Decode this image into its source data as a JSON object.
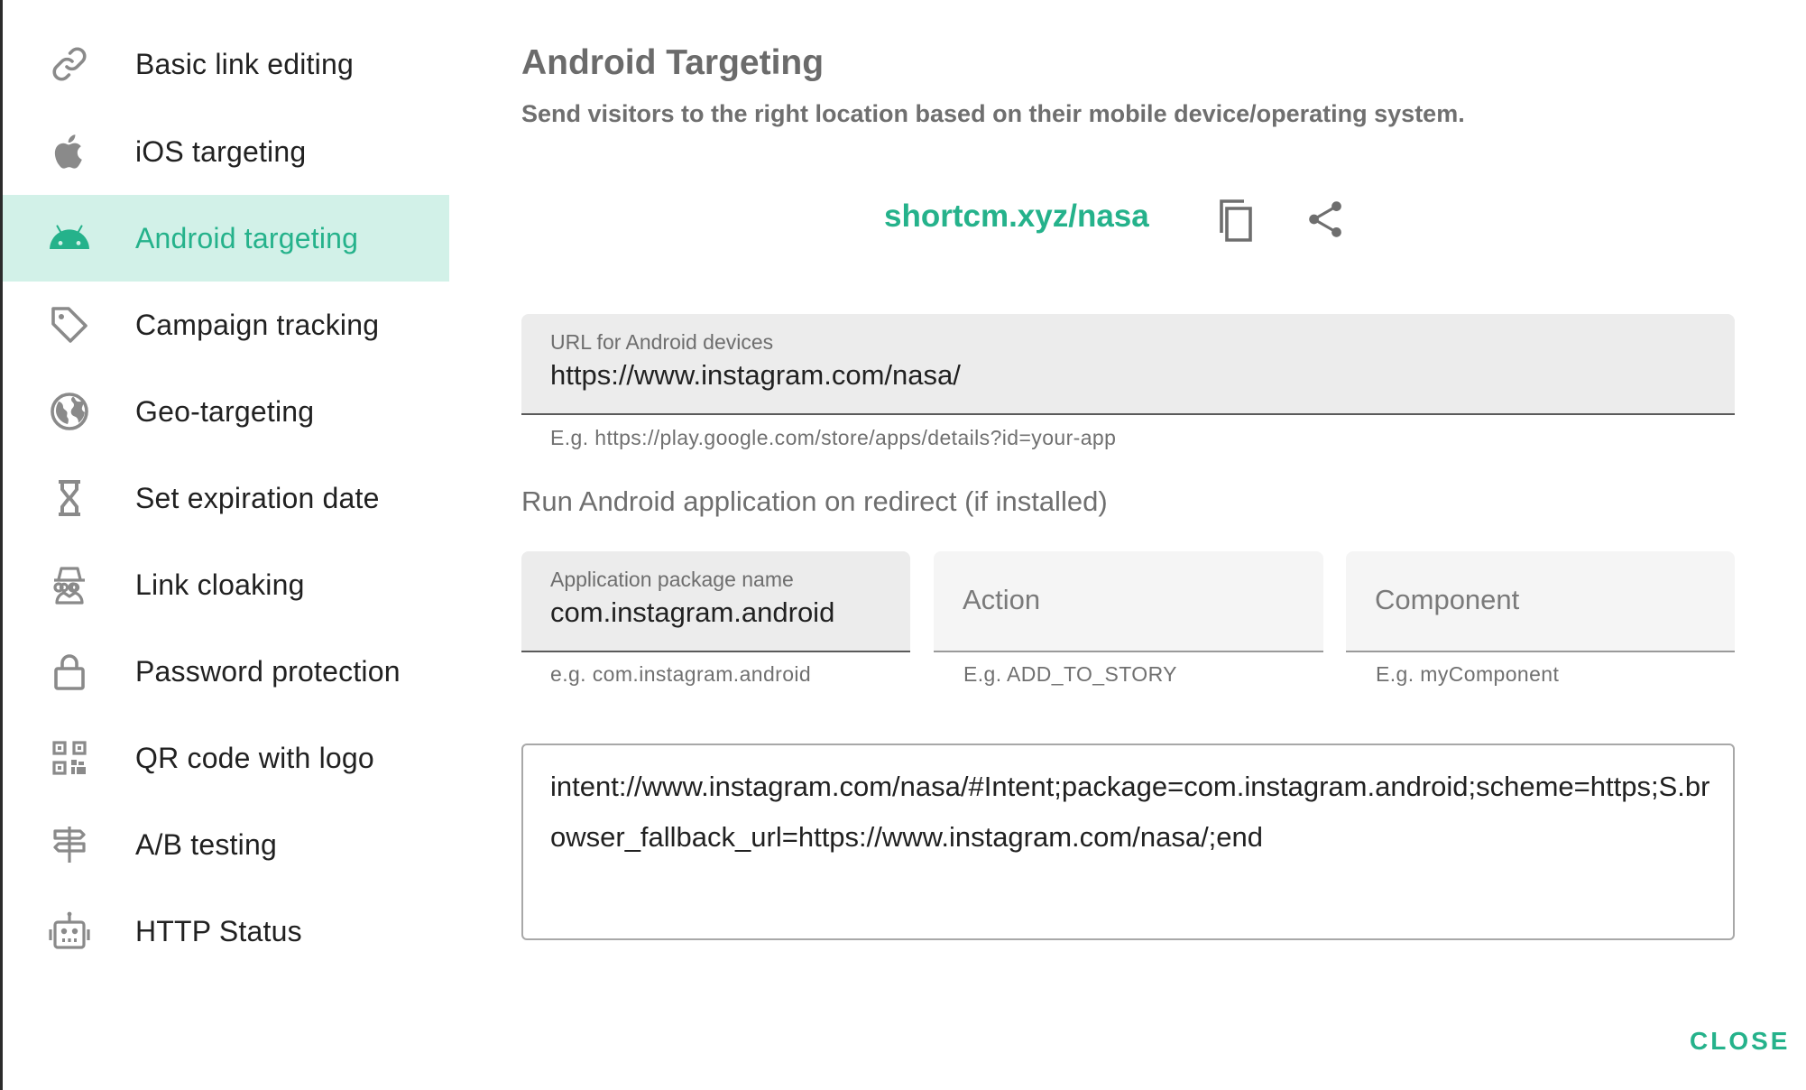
{
  "sidebar": {
    "items": [
      {
        "label": "Basic link editing",
        "icon": "link-icon"
      },
      {
        "label": "iOS targeting",
        "icon": "apple-icon"
      },
      {
        "label": "Android targeting",
        "icon": "android-icon",
        "active": true
      },
      {
        "label": "Campaign tracking",
        "icon": "tag-icon"
      },
      {
        "label": "Geo-targeting",
        "icon": "globe-icon"
      },
      {
        "label": "Set expiration date",
        "icon": "hourglass-icon"
      },
      {
        "label": "Link cloaking",
        "icon": "incognito-icon"
      },
      {
        "label": "Password protection",
        "icon": "lock-icon"
      },
      {
        "label": "QR code with logo",
        "icon": "qr-code-icon"
      },
      {
        "label": "A/B testing",
        "icon": "signpost-icon"
      },
      {
        "label": "HTTP Status",
        "icon": "robot-icon"
      }
    ]
  },
  "main": {
    "title": "Android Targeting",
    "subtitle": "Send visitors to the right location based on their mobile device/operating system.",
    "short_link": "shortcm.xyz/nasa",
    "url_field": {
      "label": "URL for Android devices",
      "value": "https://www.instagram.com/nasa/",
      "helper": "E.g. https://play.google.com/store/apps/details?id=your-app"
    },
    "app_section_label": "Run Android application on redirect (if installed)",
    "package_field": {
      "label": "Application package name",
      "value": "com.instagram.android",
      "helper": "e.g. com.instagram.android"
    },
    "action_field": {
      "placeholder": "Action",
      "helper": "E.g. ADD_TO_STORY"
    },
    "component_field": {
      "placeholder": "Component",
      "helper": "E.g. myComponent"
    },
    "intent_text": "intent://www.instagram.com/nasa/#Intent;package=com.instagram.android;scheme=https;S.browser_fallback_url=https://www.instagram.com/nasa/;end"
  },
  "footer": {
    "close_label": "CLOSE"
  },
  "colors": {
    "accent": "#25b28b",
    "active_bg": "#d2f1e8",
    "icon_gray": "#8a8a8a"
  }
}
